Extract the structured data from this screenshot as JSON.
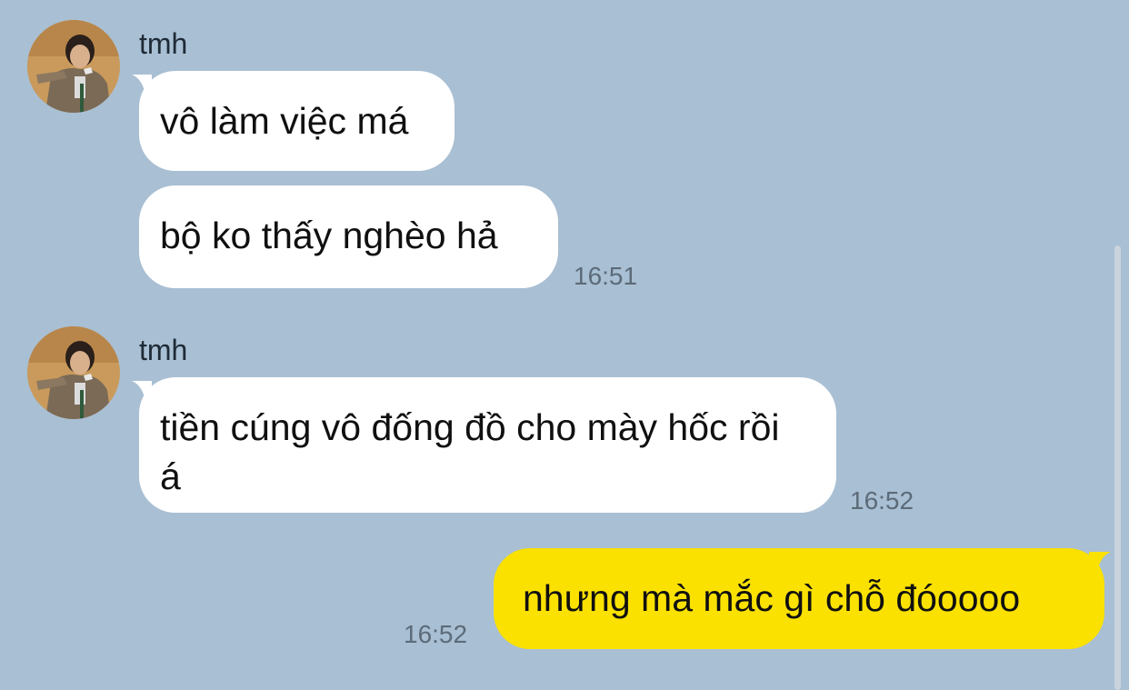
{
  "chat": {
    "background_color": "#a9bfd3",
    "incoming_bubble_color": "#ffffff",
    "outgoing_bubble_color": "#fae100",
    "messages": [
      {
        "sender": "tmh",
        "bubbles": [
          "vô làm việc má",
          "bộ ko thấy nghèo hả"
        ],
        "time": "16:51"
      },
      {
        "sender": "tmh",
        "bubbles": [
          "tiền cúng vô đống đồ cho mày hốc rồi á"
        ],
        "time": "16:52"
      },
      {
        "sender": "",
        "bubbles": [
          "nhưng mà mắc gì chỗ đóoooo"
        ],
        "time": "16:52"
      }
    ]
  }
}
